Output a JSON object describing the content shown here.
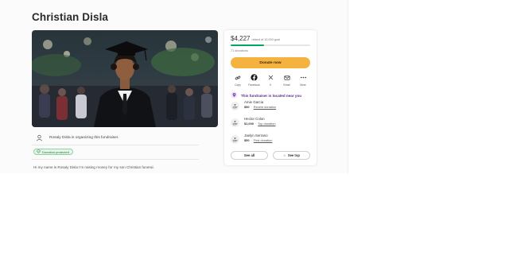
{
  "campaign": {
    "title": "Christian Disla",
    "organizer_text": "Rosaly Disla is organizing this fundraiser.",
    "badge": "Donation protected",
    "story_start": "Hi my name is Rosaly Disla I'm raising money for my son Christian funeral."
  },
  "donation": {
    "raised": "$4,227",
    "raised_suffix": "raised of 10,000 goal",
    "progress_fraction": 0.42,
    "count": "71 donations",
    "donate_label": "Donate now",
    "share": [
      {
        "icon": "link-icon",
        "label": "Copy"
      },
      {
        "icon": "facebook-icon",
        "label": "Facebook"
      },
      {
        "icon": "x-icon",
        "label": "X"
      },
      {
        "icon": "email-icon",
        "label": "Email"
      },
      {
        "icon": "more-icon",
        "label": "More"
      }
    ],
    "nearby": "This fundraiser is located near you",
    "donors": [
      {
        "name": "Amie Garcia",
        "amount": "$50",
        "tag": "Recent donation"
      },
      {
        "name": "Hector Colon",
        "amount": "$1,000",
        "tag": "Top donation"
      },
      {
        "name": "Jaelyn Serrano",
        "amount": "$50",
        "tag": "First donation"
      }
    ],
    "see_all": "See all",
    "see_top": "See top"
  },
  "colors": {
    "accent_green": "#02a95c",
    "donate_button": "#f6b23f",
    "nearby_purple": "#5b2d8c"
  }
}
